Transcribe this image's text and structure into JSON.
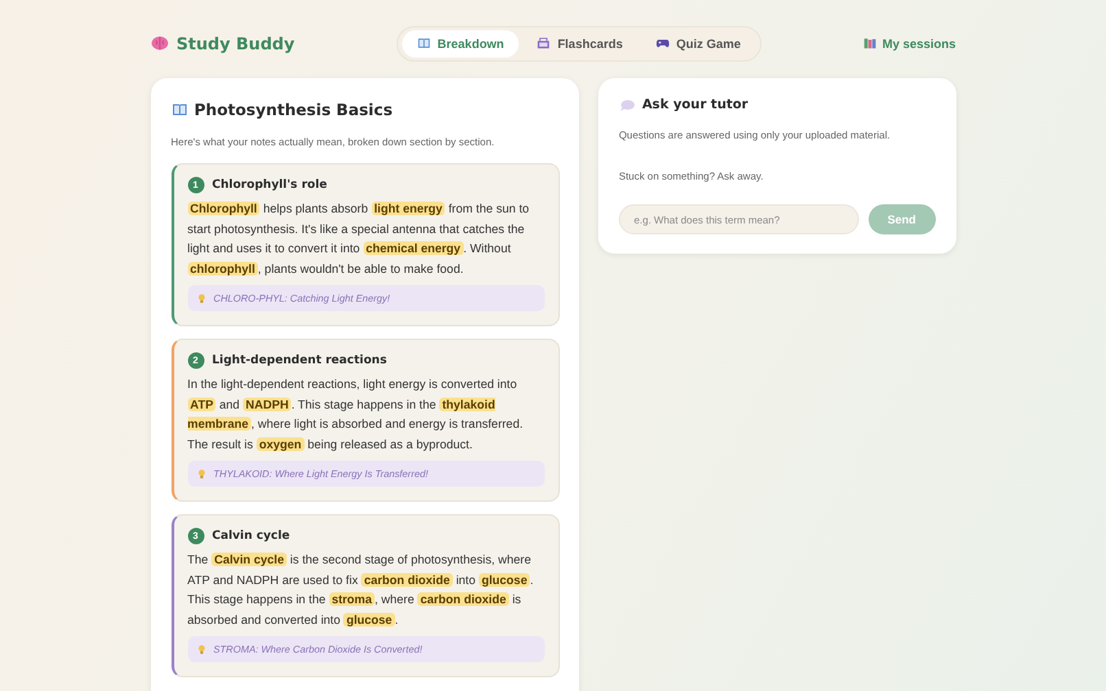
{
  "brand": {
    "name": "Study Buddy"
  },
  "tabs": [
    {
      "label": "Breakdown",
      "kind": "book",
      "selected": true
    },
    {
      "label": "Flashcards",
      "kind": "box",
      "selected": false
    },
    {
      "label": "Quiz Game",
      "kind": "gamepad",
      "selected": false
    }
  ],
  "sessions_link": "My sessions",
  "breakdown": {
    "title": "Photosynthesis Basics",
    "subtitle": "Here's what your notes actually mean, broken down section by section.",
    "sections": [
      {
        "number": "1",
        "title": "Chlorophyll's role",
        "color": "#4e9a72",
        "text": "**Chlorophyll** helps plants absorb **light energy** from the sun to start photosynthesis. It's like a special antenna that catches the light and uses it to convert it into **chemical energy**. Without **chlorophyll**, plants wouldn't be able to make food.",
        "mnemonic": "CHLORO-PHYL: Catching Light Energy!"
      },
      {
        "number": "2",
        "title": "Light-dependent reactions",
        "color": "#eea366",
        "text": "In the light-dependent reactions, light energy is converted into **ATP** and **NADPH**. This stage happens in the **thylakoid membrane**, where light is absorbed and energy is transferred. The result is **oxygen** being released as a byproduct.",
        "mnemonic": "THYLAKOID: Where Light Energy Is Transferred!"
      },
      {
        "number": "3",
        "title": "Calvin cycle",
        "color": "#9a82c8",
        "text": "The **Calvin cycle** is the second stage of photosynthesis, where ATP and NADPH are used to fix **carbon dioxide** into **glucose**. This stage happens in the **stroma**, where **carbon dioxide** is absorbed and converted into **glucose**.",
        "mnemonic": "STROMA: Where Carbon Dioxide Is Converted!"
      }
    ]
  },
  "tutor": {
    "title": "Ask your tutor",
    "note": "Questions are answered using only your uploaded material.",
    "prompt": "Stuck on something? Ask away.",
    "placeholder": "e.g. What does this term mean?",
    "send": {
      "label": "Send",
      "disabled": true
    }
  }
}
